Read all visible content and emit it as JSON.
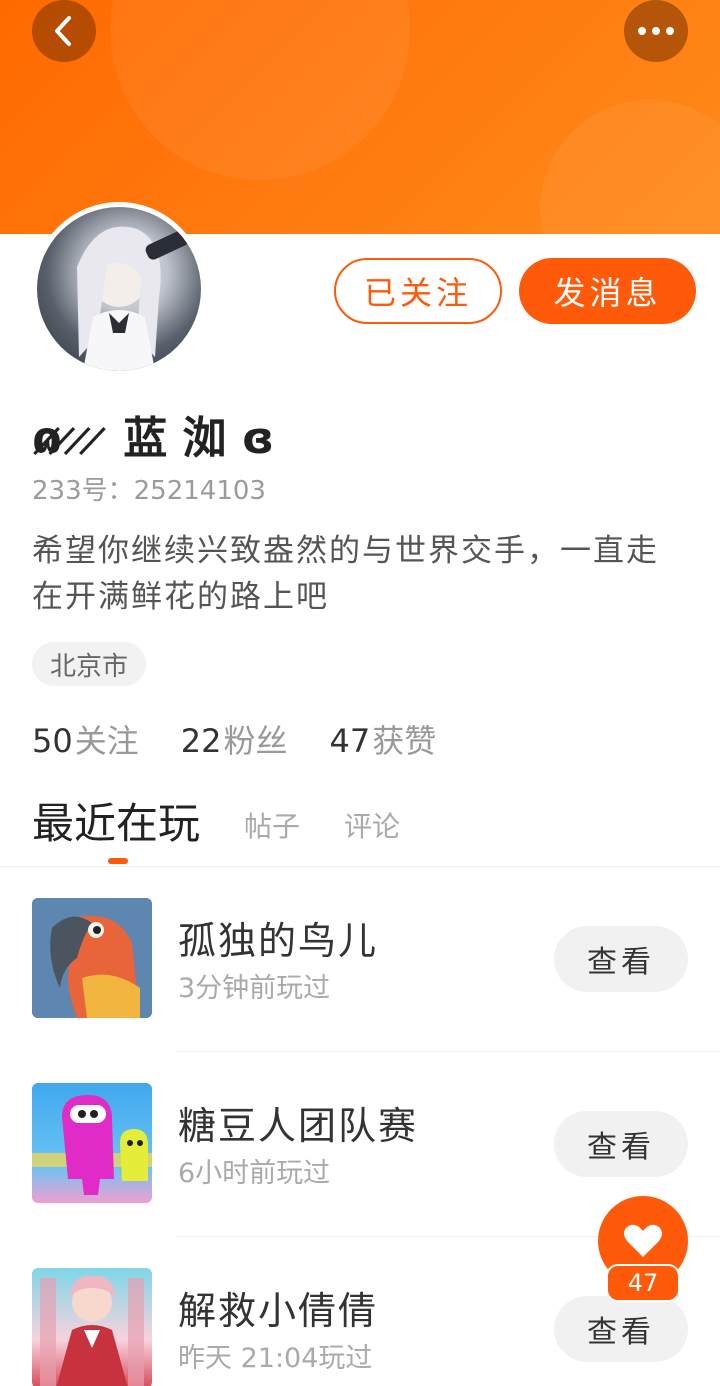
{
  "profile": {
    "username": "ɷ̷ ̷ ̷ ̷ 蓝 洳 ɞ",
    "uid_label": "233号：",
    "uid_value": "25214103",
    "bio": "希望你继续兴致盎然的与世界交手，一直走在开满鲜花的路上吧",
    "location": "北京市"
  },
  "actions": {
    "follow_label": "已关注",
    "message_label": "发消息"
  },
  "stats": [
    {
      "value": "50",
      "label": "关注"
    },
    {
      "value": "22",
      "label": "粉丝"
    },
    {
      "value": "47",
      "label": "获赞"
    }
  ],
  "tabs": [
    {
      "label": "最近在玩",
      "active": true
    },
    {
      "label": "帖子",
      "active": false
    },
    {
      "label": "评论",
      "active": false
    }
  ],
  "games": [
    {
      "title": "孤独的鸟儿",
      "time": "3分钟前玩过",
      "button": "查看",
      "icon": "parrot-game-icon"
    },
    {
      "title": "糖豆人团队赛",
      "time": "6小时前玩过",
      "button": "查看",
      "icon": "fall-guys-game-icon"
    },
    {
      "title": "解救小倩倩",
      "time": "昨天 21:04玩过",
      "button": "查看",
      "icon": "anime-girl-game-icon"
    }
  ],
  "like": {
    "count": "47"
  },
  "colors": {
    "accent": "#ff5a0a",
    "banner": "#ff7a10"
  }
}
